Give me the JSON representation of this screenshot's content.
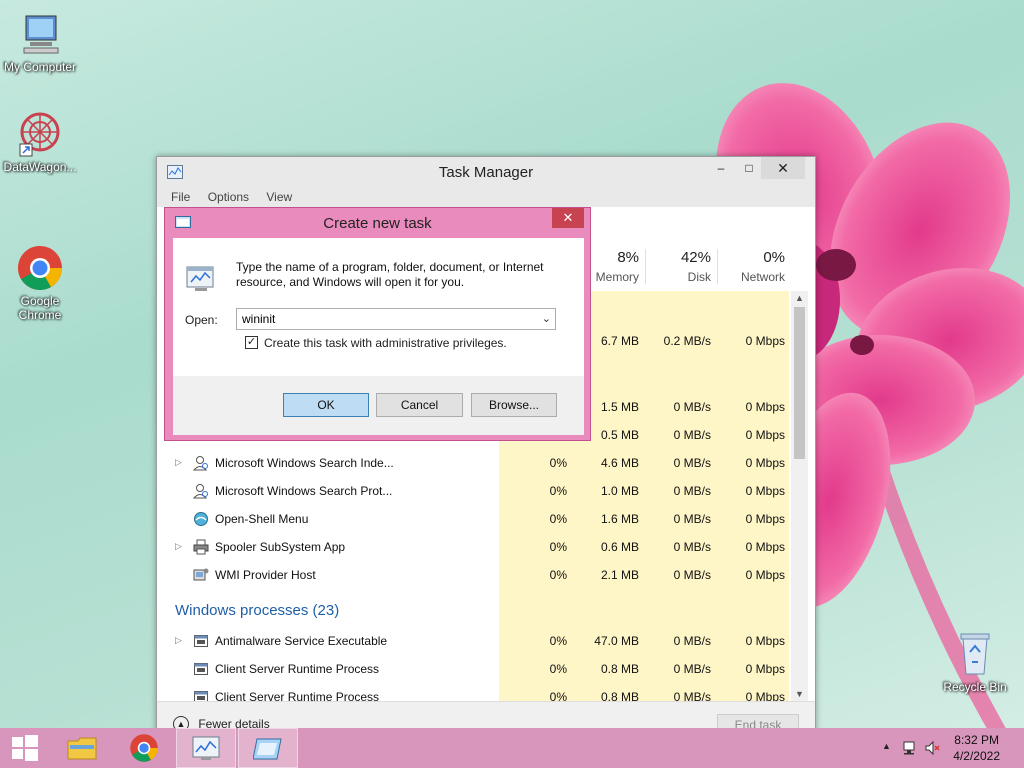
{
  "desktop": {
    "icons": [
      {
        "label": "My Computer"
      },
      {
        "label": "DataWagon..."
      },
      {
        "label": "Google\nChrome"
      },
      {
        "label": "Recycle Bin"
      }
    ]
  },
  "task_manager": {
    "title": "Task Manager",
    "menu": [
      "File",
      "Options",
      "View"
    ],
    "columns": [
      {
        "pct": "8%",
        "label": "Memory"
      },
      {
        "pct": "42%",
        "label": "Disk"
      },
      {
        "pct": "0%",
        "label": "Network"
      }
    ],
    "hidden_rows": [
      {
        "memory": "6.7 MB",
        "disk": "0.2 MB/s",
        "network": "0 Mbps"
      },
      {
        "memory": "1.5 MB",
        "disk": "0 MB/s",
        "network": "0 Mbps"
      },
      {
        "memory": "0.5 MB",
        "disk": "0 MB/s",
        "network": "0 Mbps"
      }
    ],
    "rows": [
      {
        "name": "Microsoft Windows Search Inde...",
        "cpu": "0%",
        "memory": "4.6 MB",
        "disk": "0 MB/s",
        "network": "0 Mbps",
        "expandable": true,
        "icon": "search-person-icon"
      },
      {
        "name": "Microsoft Windows Search Prot...",
        "cpu": "0%",
        "memory": "1.0 MB",
        "disk": "0 MB/s",
        "network": "0 Mbps",
        "expandable": false,
        "icon": "search-person-icon"
      },
      {
        "name": "Open-Shell Menu",
        "cpu": "0%",
        "memory": "1.6 MB",
        "disk": "0 MB/s",
        "network": "0 Mbps",
        "expandable": false,
        "icon": "shell-icon"
      },
      {
        "name": "Spooler SubSystem App",
        "cpu": "0%",
        "memory": "0.6 MB",
        "disk": "0 MB/s",
        "network": "0 Mbps",
        "expandable": true,
        "icon": "printer-icon"
      },
      {
        "name": "WMI Provider Host",
        "cpu": "0%",
        "memory": "2.1 MB",
        "disk": "0 MB/s",
        "network": "0 Mbps",
        "expandable": false,
        "icon": "wmi-icon"
      }
    ],
    "section_title": "Windows processes (23)",
    "windows_rows": [
      {
        "name": "Antimalware Service Executable",
        "cpu": "0%",
        "memory": "47.0 MB",
        "disk": "0 MB/s",
        "network": "0 Mbps",
        "expandable": true,
        "icon": "app-icon"
      },
      {
        "name": "Client Server Runtime Process",
        "cpu": "0%",
        "memory": "0.8 MB",
        "disk": "0 MB/s",
        "network": "0 Mbps",
        "expandable": false,
        "icon": "app-icon"
      },
      {
        "name": "Client Server Runtime Process",
        "cpu": "0%",
        "memory": "0.8 MB",
        "disk": "0 MB/s",
        "network": "0 Mbps",
        "expandable": false,
        "icon": "app-icon"
      }
    ],
    "fewer_details": "Fewer details",
    "end_task": "End task"
  },
  "dialog": {
    "title": "Create new task",
    "description": "Type the name of a program, folder, document, or Internet resource, and Windows will open it for you.",
    "open_label": "Open:",
    "open_value": "wininit",
    "admin_checkbox_label": "Create this task with administrative privileges.",
    "admin_checked": true,
    "ok": "OK",
    "cancel": "Cancel",
    "browse": "Browse..."
  },
  "taskbar": {
    "time": "8:32 PM",
    "date": "4/2/2022"
  }
}
